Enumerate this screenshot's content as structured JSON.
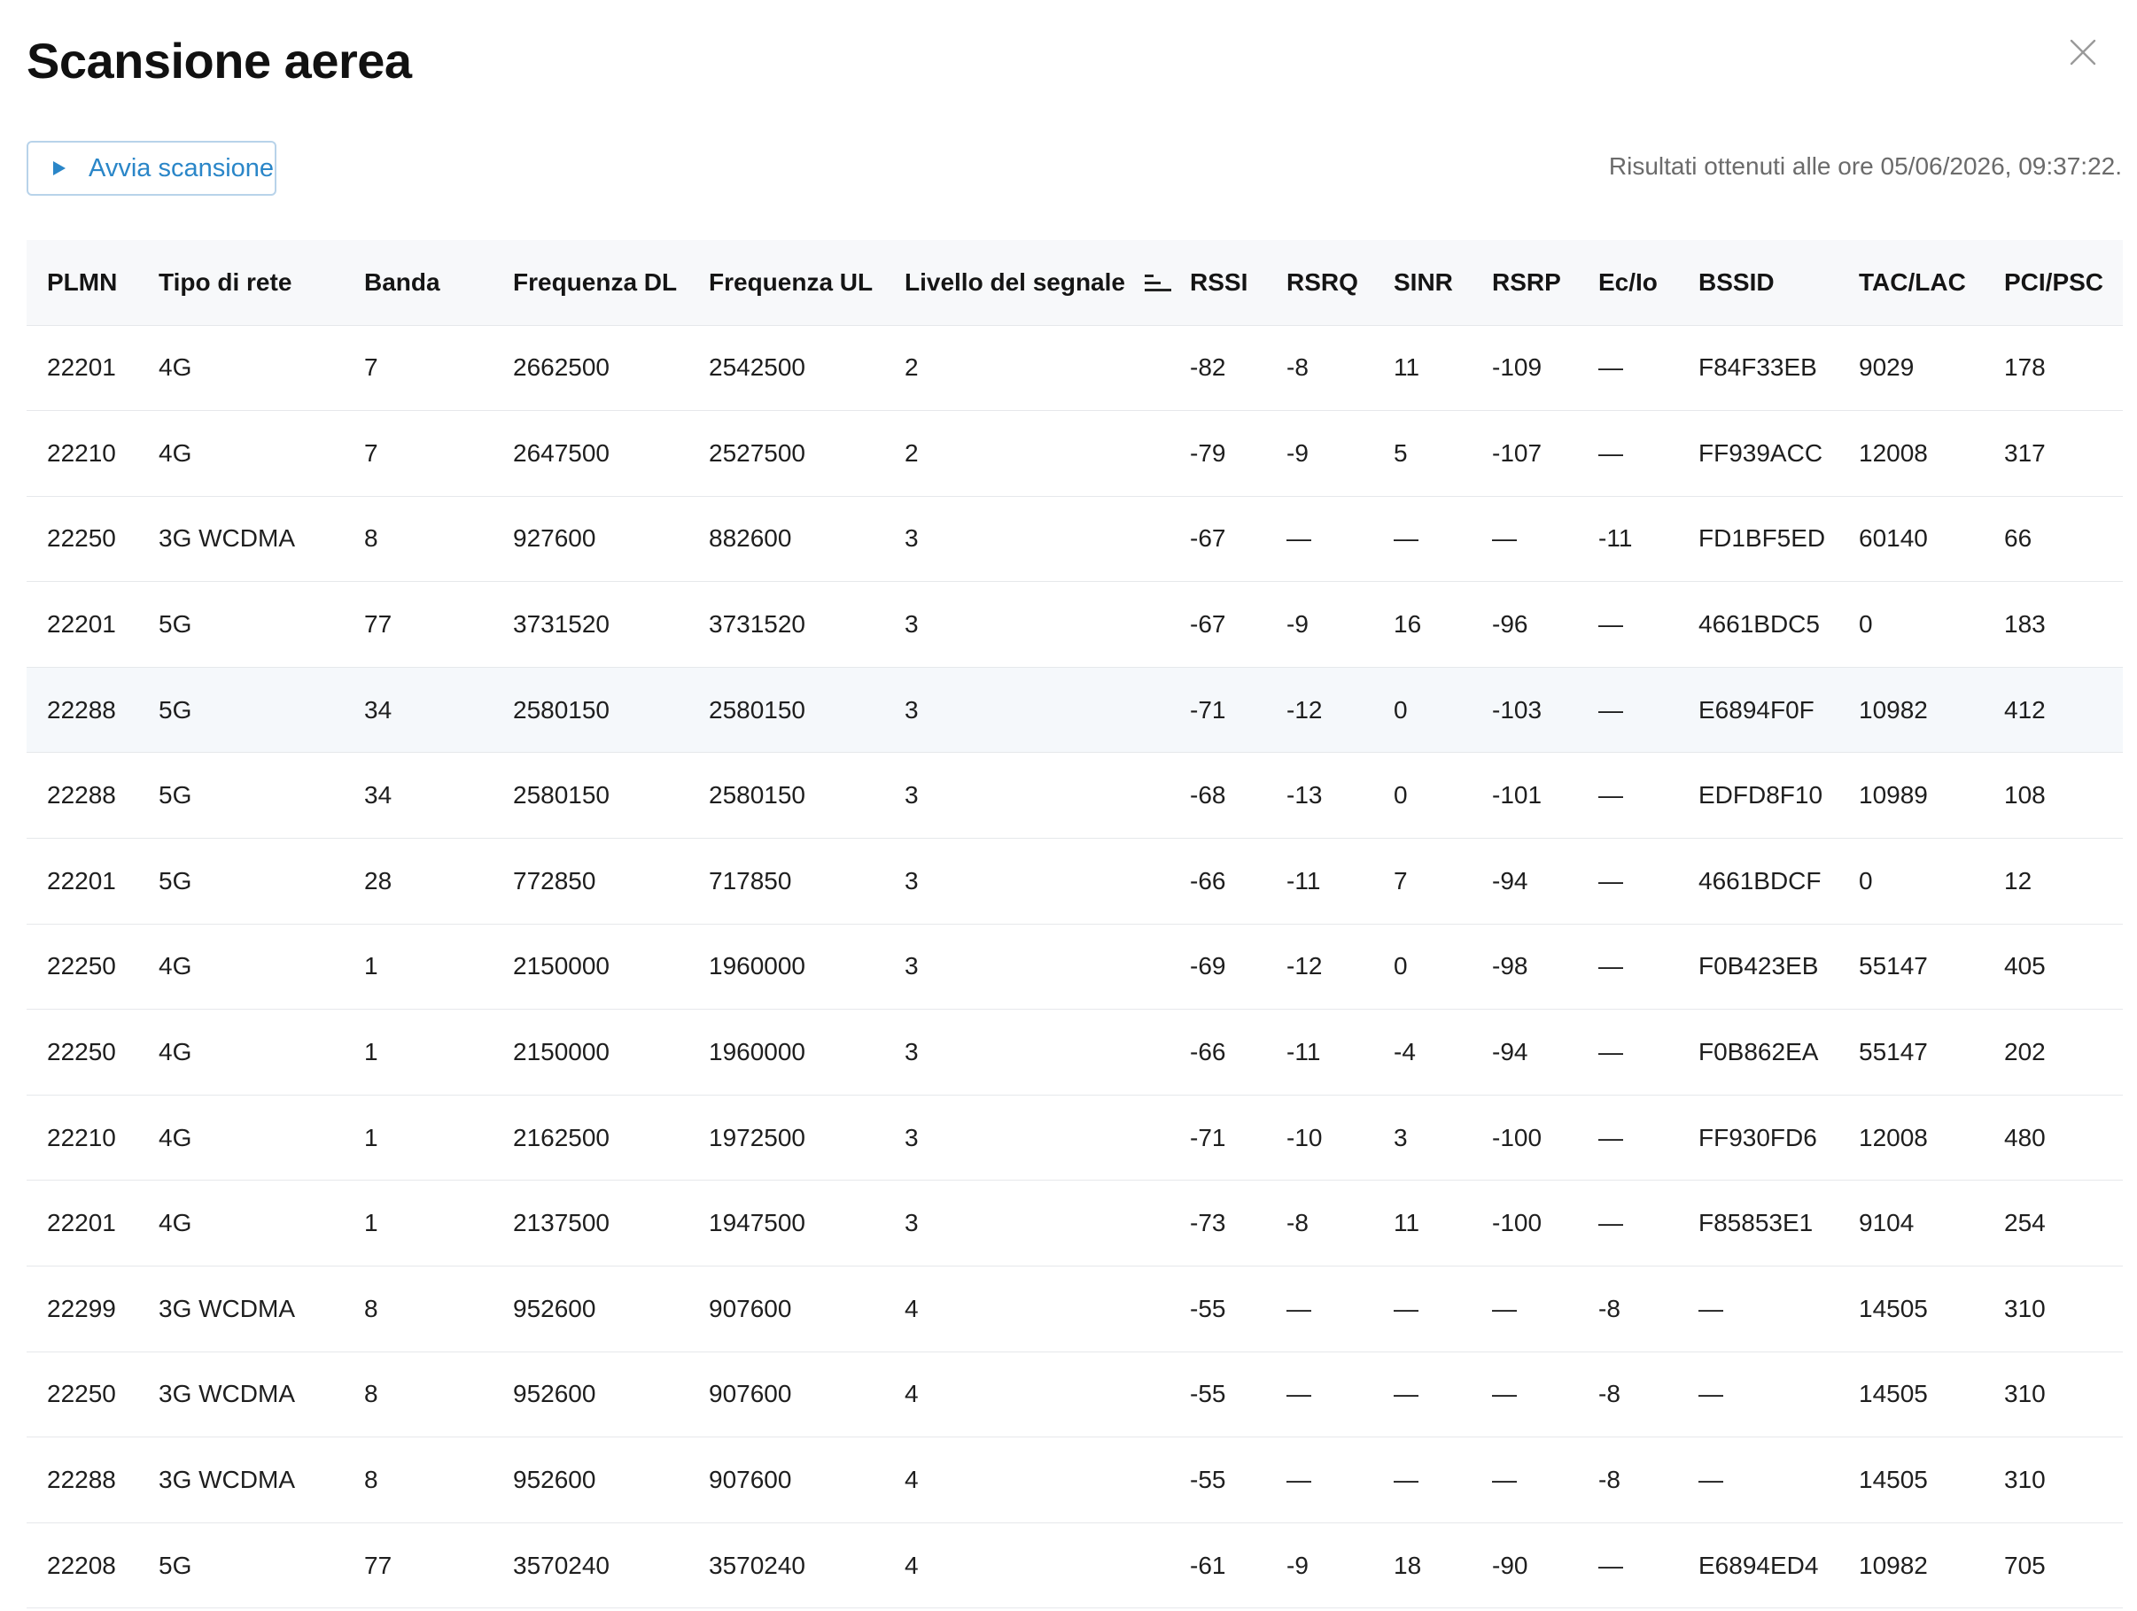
{
  "dialog": {
    "title": "Scansione aerea",
    "scan_button_label": "Avvia scansione",
    "results_time": "Risultati ottenuti alle ore 05/06/2026, 09:37:22."
  },
  "icons": {
    "close": "close-icon",
    "play": "play-icon",
    "sort": "sort-descending-icon"
  },
  "colors": {
    "accent": "#2a86c8",
    "button_border": "#b8d3ea",
    "header_bg": "#f7f8fa",
    "row_highlight": "#f5f8fb"
  },
  "table": {
    "columns": [
      "PLMN",
      "Tipo di rete",
      "Banda",
      "Frequenza DL",
      "Frequenza UL",
      "Livello del segnale",
      "RSSI",
      "RSRQ",
      "SINR",
      "RSRP",
      "Ec/Io",
      "BSSID",
      "TAC/LAC",
      "PCI/PSC"
    ],
    "sorted_column": "Livello del segnale",
    "highlighted_row": 4,
    "rows": [
      [
        "22201",
        "4G",
        "7",
        "2662500",
        "2542500",
        "2",
        "-82",
        "-8",
        "11",
        "-109",
        "—",
        "F84F33EB",
        "9029",
        "178"
      ],
      [
        "22210",
        "4G",
        "7",
        "2647500",
        "2527500",
        "2",
        "-79",
        "-9",
        "5",
        "-107",
        "—",
        "FF939ACC",
        "12008",
        "317"
      ],
      [
        "22250",
        "3G WCDMA",
        "8",
        "927600",
        "882600",
        "3",
        "-67",
        "—",
        "—",
        "—",
        "-11",
        "FD1BF5ED",
        "60140",
        "66"
      ],
      [
        "22201",
        "5G",
        "77",
        "3731520",
        "3731520",
        "3",
        "-67",
        "-9",
        "16",
        "-96",
        "—",
        "4661BDC5",
        "0",
        "183"
      ],
      [
        "22288",
        "5G",
        "34",
        "2580150",
        "2580150",
        "3",
        "-71",
        "-12",
        "0",
        "-103",
        "—",
        "E6894F0F",
        "10982",
        "412"
      ],
      [
        "22288",
        "5G",
        "34",
        "2580150",
        "2580150",
        "3",
        "-68",
        "-13",
        "0",
        "-101",
        "—",
        "EDFD8F10",
        "10989",
        "108"
      ],
      [
        "22201",
        "5G",
        "28",
        "772850",
        "717850",
        "3",
        "-66",
        "-11",
        "7",
        "-94",
        "—",
        "4661BDCF",
        "0",
        "12"
      ],
      [
        "22250",
        "4G",
        "1",
        "2150000",
        "1960000",
        "3",
        "-69",
        "-12",
        "0",
        "-98",
        "—",
        "F0B423EB",
        "55147",
        "405"
      ],
      [
        "22250",
        "4G",
        "1",
        "2150000",
        "1960000",
        "3",
        "-66",
        "-11",
        "-4",
        "-94",
        "—",
        "F0B862EA",
        "55147",
        "202"
      ],
      [
        "22210",
        "4G",
        "1",
        "2162500",
        "1972500",
        "3",
        "-71",
        "-10",
        "3",
        "-100",
        "—",
        "FF930FD6",
        "12008",
        "480"
      ],
      [
        "22201",
        "4G",
        "1",
        "2137500",
        "1947500",
        "3",
        "-73",
        "-8",
        "11",
        "-100",
        "—",
        "F85853E1",
        "9104",
        "254"
      ],
      [
        "22299",
        "3G WCDMA",
        "8",
        "952600",
        "907600",
        "4",
        "-55",
        "—",
        "—",
        "—",
        "-8",
        "—",
        "14505",
        "310"
      ],
      [
        "22250",
        "3G WCDMA",
        "8",
        "952600",
        "907600",
        "4",
        "-55",
        "—",
        "—",
        "—",
        "-8",
        "—",
        "14505",
        "310"
      ],
      [
        "22288",
        "3G WCDMA",
        "8",
        "952600",
        "907600",
        "4",
        "-55",
        "—",
        "—",
        "—",
        "-8",
        "—",
        "14505",
        "310"
      ],
      [
        "22208",
        "5G",
        "77",
        "3570240",
        "3570240",
        "4",
        "-61",
        "-9",
        "18",
        "-90",
        "—",
        "E6894ED4",
        "10982",
        "705"
      ]
    ]
  }
}
